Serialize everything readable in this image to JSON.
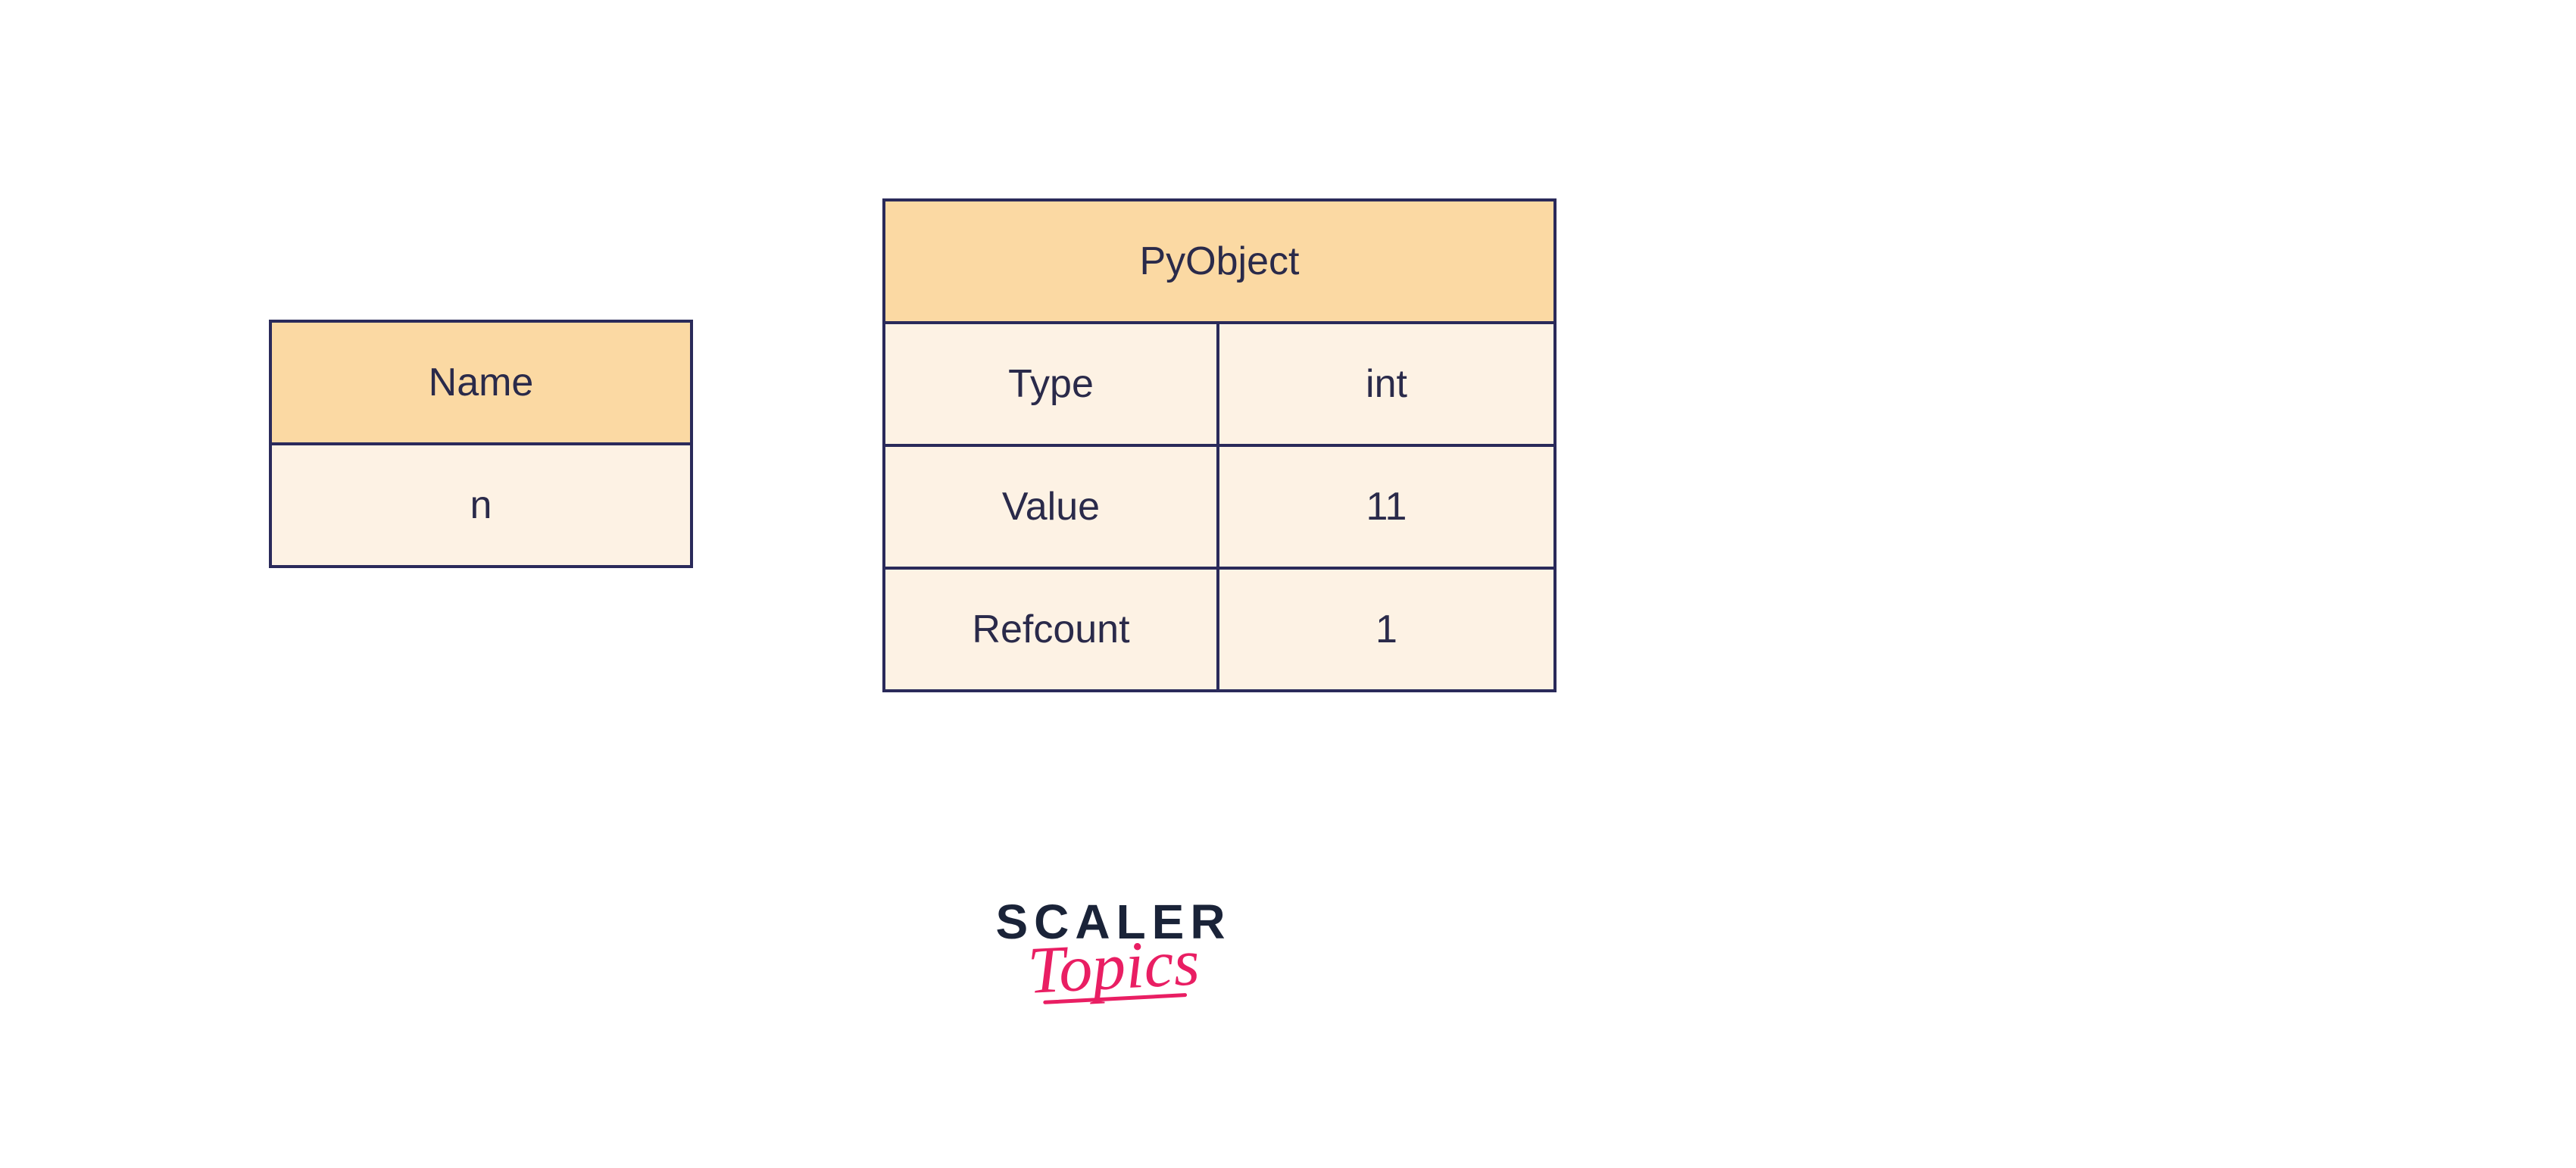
{
  "name_table": {
    "header": "Name",
    "value": "n"
  },
  "pyobject_table": {
    "title": "PyObject",
    "rows": [
      {
        "label": "Type",
        "value": "int"
      },
      {
        "label": "Value",
        "value": "11"
      },
      {
        "label": "Refcount",
        "value": "1"
      }
    ]
  },
  "logo": {
    "line1": "SCALER",
    "line2": "Topics"
  },
  "colors": {
    "border": "#2a2a5a",
    "header_bg": "#fbd9a3",
    "body_bg": "#fdf2e4",
    "logo_dark": "#1a2338",
    "logo_pink": "#e91e63"
  }
}
